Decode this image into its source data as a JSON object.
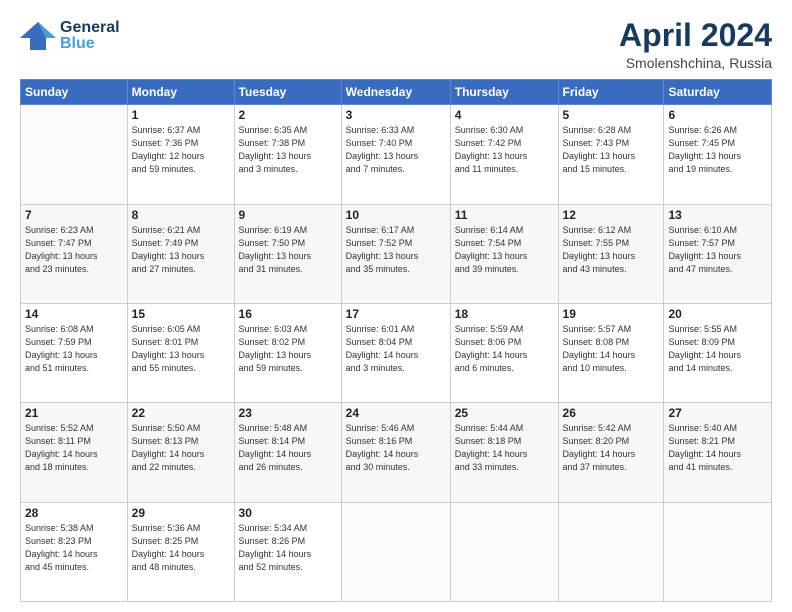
{
  "header": {
    "logo_general": "General",
    "logo_blue": "Blue",
    "main_title": "April 2024",
    "subtitle": "Smolenshchina, Russia"
  },
  "calendar": {
    "days_of_week": [
      "Sunday",
      "Monday",
      "Tuesday",
      "Wednesday",
      "Thursday",
      "Friday",
      "Saturday"
    ],
    "weeks": [
      [
        {
          "day": "",
          "info": ""
        },
        {
          "day": "1",
          "info": "Sunrise: 6:37 AM\nSunset: 7:36 PM\nDaylight: 12 hours\nand 59 minutes."
        },
        {
          "day": "2",
          "info": "Sunrise: 6:35 AM\nSunset: 7:38 PM\nDaylight: 13 hours\nand 3 minutes."
        },
        {
          "day": "3",
          "info": "Sunrise: 6:33 AM\nSunset: 7:40 PM\nDaylight: 13 hours\nand 7 minutes."
        },
        {
          "day": "4",
          "info": "Sunrise: 6:30 AM\nSunset: 7:42 PM\nDaylight: 13 hours\nand 11 minutes."
        },
        {
          "day": "5",
          "info": "Sunrise: 6:28 AM\nSunset: 7:43 PM\nDaylight: 13 hours\nand 15 minutes."
        },
        {
          "day": "6",
          "info": "Sunrise: 6:26 AM\nSunset: 7:45 PM\nDaylight: 13 hours\nand 19 minutes."
        }
      ],
      [
        {
          "day": "7",
          "info": "Sunrise: 6:23 AM\nSunset: 7:47 PM\nDaylight: 13 hours\nand 23 minutes."
        },
        {
          "day": "8",
          "info": "Sunrise: 6:21 AM\nSunset: 7:49 PM\nDaylight: 13 hours\nand 27 minutes."
        },
        {
          "day": "9",
          "info": "Sunrise: 6:19 AM\nSunset: 7:50 PM\nDaylight: 13 hours\nand 31 minutes."
        },
        {
          "day": "10",
          "info": "Sunrise: 6:17 AM\nSunset: 7:52 PM\nDaylight: 13 hours\nand 35 minutes."
        },
        {
          "day": "11",
          "info": "Sunrise: 6:14 AM\nSunset: 7:54 PM\nDaylight: 13 hours\nand 39 minutes."
        },
        {
          "day": "12",
          "info": "Sunrise: 6:12 AM\nSunset: 7:55 PM\nDaylight: 13 hours\nand 43 minutes."
        },
        {
          "day": "13",
          "info": "Sunrise: 6:10 AM\nSunset: 7:57 PM\nDaylight: 13 hours\nand 47 minutes."
        }
      ],
      [
        {
          "day": "14",
          "info": "Sunrise: 6:08 AM\nSunset: 7:59 PM\nDaylight: 13 hours\nand 51 minutes."
        },
        {
          "day": "15",
          "info": "Sunrise: 6:05 AM\nSunset: 8:01 PM\nDaylight: 13 hours\nand 55 minutes."
        },
        {
          "day": "16",
          "info": "Sunrise: 6:03 AM\nSunset: 8:02 PM\nDaylight: 13 hours\nand 59 minutes."
        },
        {
          "day": "17",
          "info": "Sunrise: 6:01 AM\nSunset: 8:04 PM\nDaylight: 14 hours\nand 3 minutes."
        },
        {
          "day": "18",
          "info": "Sunrise: 5:59 AM\nSunset: 8:06 PM\nDaylight: 14 hours\nand 6 minutes."
        },
        {
          "day": "19",
          "info": "Sunrise: 5:57 AM\nSunset: 8:08 PM\nDaylight: 14 hours\nand 10 minutes."
        },
        {
          "day": "20",
          "info": "Sunrise: 5:55 AM\nSunset: 8:09 PM\nDaylight: 14 hours\nand 14 minutes."
        }
      ],
      [
        {
          "day": "21",
          "info": "Sunrise: 5:52 AM\nSunset: 8:11 PM\nDaylight: 14 hours\nand 18 minutes."
        },
        {
          "day": "22",
          "info": "Sunrise: 5:50 AM\nSunset: 8:13 PM\nDaylight: 14 hours\nand 22 minutes."
        },
        {
          "day": "23",
          "info": "Sunrise: 5:48 AM\nSunset: 8:14 PM\nDaylight: 14 hours\nand 26 minutes."
        },
        {
          "day": "24",
          "info": "Sunrise: 5:46 AM\nSunset: 8:16 PM\nDaylight: 14 hours\nand 30 minutes."
        },
        {
          "day": "25",
          "info": "Sunrise: 5:44 AM\nSunset: 8:18 PM\nDaylight: 14 hours\nand 33 minutes."
        },
        {
          "day": "26",
          "info": "Sunrise: 5:42 AM\nSunset: 8:20 PM\nDaylight: 14 hours\nand 37 minutes."
        },
        {
          "day": "27",
          "info": "Sunrise: 5:40 AM\nSunset: 8:21 PM\nDaylight: 14 hours\nand 41 minutes."
        }
      ],
      [
        {
          "day": "28",
          "info": "Sunrise: 5:38 AM\nSunset: 8:23 PM\nDaylight: 14 hours\nand 45 minutes."
        },
        {
          "day": "29",
          "info": "Sunrise: 5:36 AM\nSunset: 8:25 PM\nDaylight: 14 hours\nand 48 minutes."
        },
        {
          "day": "30",
          "info": "Sunrise: 5:34 AM\nSunset: 8:26 PM\nDaylight: 14 hours\nand 52 minutes."
        },
        {
          "day": "",
          "info": ""
        },
        {
          "day": "",
          "info": ""
        },
        {
          "day": "",
          "info": ""
        },
        {
          "day": "",
          "info": ""
        }
      ]
    ]
  }
}
